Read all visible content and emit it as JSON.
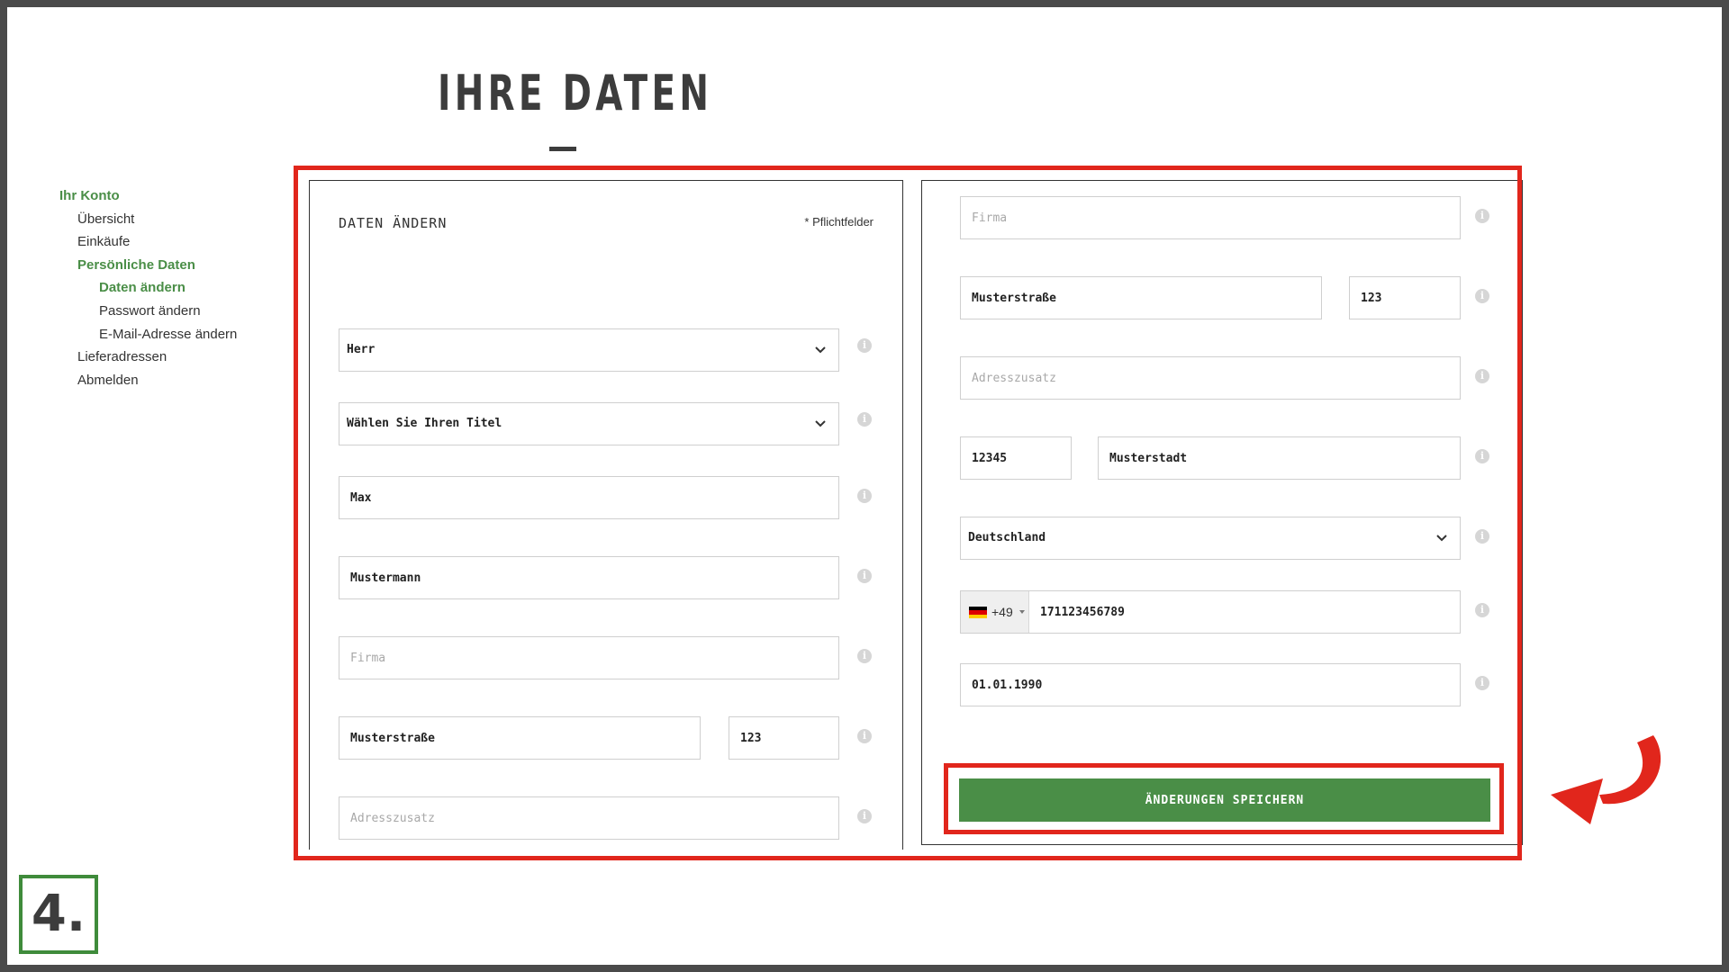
{
  "page": {
    "title": "IHRE DATEN"
  },
  "sidebar": {
    "items": [
      {
        "label": "Ihr Konto",
        "level": 1,
        "active": true
      },
      {
        "label": "Übersicht",
        "level": 2,
        "active": false
      },
      {
        "label": "Einkäufe",
        "level": 2,
        "active": false
      },
      {
        "label": "Persönliche Daten",
        "level": 2,
        "active": true
      },
      {
        "label": "Daten ändern",
        "level": 3,
        "active": true
      },
      {
        "label": "Passwort ändern",
        "level": 3,
        "active": false
      },
      {
        "label": "E-Mail-Adresse ändern",
        "level": 3,
        "active": false
      },
      {
        "label": "Lieferadressen",
        "level": 2,
        "active": false
      },
      {
        "label": "Abmelden",
        "level": 2,
        "active": false
      }
    ]
  },
  "form": {
    "heading": "DATEN ÄNDERN",
    "required_note": "* Pflichtfelder",
    "left": {
      "salutation": "Herr",
      "title": "Wählen Sie Ihren Titel",
      "first_name": "Max",
      "last_name": "Mustermann",
      "company_placeholder": "Firma",
      "street": "Musterstraße",
      "house_number": "123",
      "address_extra_placeholder": "Adresszusatz"
    },
    "right": {
      "company_placeholder": "Firma",
      "street": "Musterstraße",
      "house_number": "123",
      "address_extra_placeholder": "Adresszusatz",
      "zip": "12345",
      "city": "Musterstadt",
      "country": "Deutschland",
      "phone_code": "+49",
      "phone": "171123456789",
      "birthdate": "01.01.1990"
    },
    "save_label": "ÄNDERUNGEN SPEICHERN"
  },
  "step": {
    "label": "4."
  },
  "colors": {
    "accent": "#4a8e47",
    "highlight": "#e1261c"
  },
  "icons": {
    "info": "info-icon",
    "chevron": "chevron-down-icon",
    "arrow": "curved-arrow-icon",
    "flag": "flag-de-icon"
  }
}
